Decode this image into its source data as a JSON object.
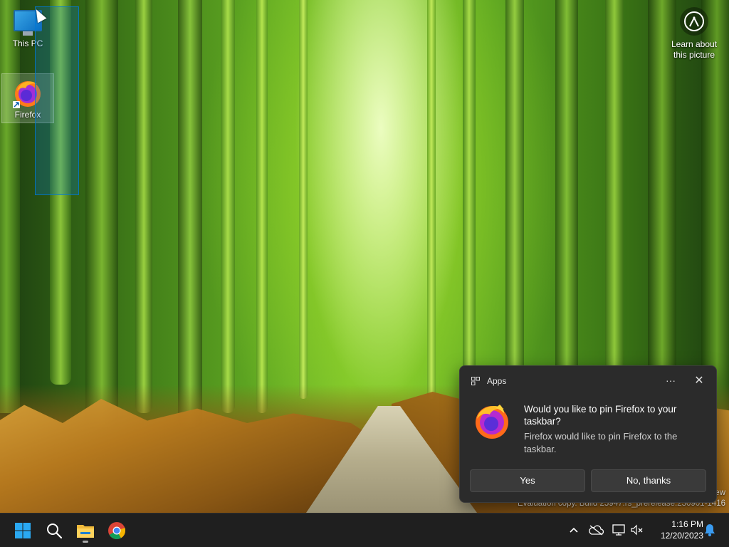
{
  "desktop": {
    "icons": [
      {
        "label": "This PC"
      },
      {
        "label": "Firefox"
      }
    ],
    "learn_about": {
      "label": "Learn about this picture"
    },
    "watermark": {
      "line1": "ew",
      "line2": "Evaluation copy. Build 25947.rs_prerelease.230901-1416"
    }
  },
  "toast": {
    "app_name": "Apps",
    "more_label": "···",
    "close_label": "✕",
    "title": "Would you like to pin Firefox to your taskbar?",
    "body": "Firefox would like to pin Firefox to the taskbar.",
    "yes_label": "Yes",
    "no_label": "No, thanks"
  },
  "taskbar": {
    "pinned": [
      "start-icon",
      "search-icon",
      "file-explorer-icon",
      "chrome-icon"
    ],
    "tray": [
      "chevron-up-icon",
      "onedrive-icon",
      "network-icon",
      "volume-muted-icon",
      "notification-bell-icon"
    ],
    "time": "1:16 PM",
    "date": "12/20/2023"
  },
  "colors": {
    "accent": "#0078d4",
    "toast_bg": "#2b2b2b",
    "taskbar_bg": "#1f1f1f"
  }
}
